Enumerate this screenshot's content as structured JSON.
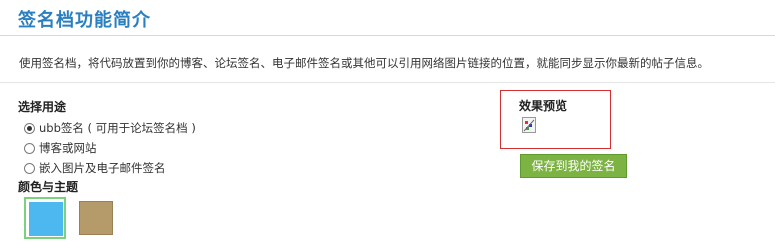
{
  "header": {
    "title": "签名档功能简介"
  },
  "description": "使用签名档，将代码放置到你的博客、论坛签名、电子邮件签名或其他可以引用网络图片链接的位置，就能同步显示你最新的帖子信息。",
  "purpose": {
    "label": "选择用途",
    "options": [
      {
        "label": "ubb签名 ( 可用于论坛签名档 )",
        "checked": true
      },
      {
        "label": "博客或网站",
        "checked": false
      },
      {
        "label": "嵌入图片及电子邮件签名",
        "checked": false
      }
    ]
  },
  "theme": {
    "label": "颜色与主题",
    "swatches": [
      {
        "color": "#4db8ef",
        "selected": true
      },
      {
        "color": "#b59a6a",
        "selected": false
      }
    ]
  },
  "preview": {
    "label": "效果预览",
    "icon": "broken-image-icon"
  },
  "save_button": "保存到我的签名"
}
